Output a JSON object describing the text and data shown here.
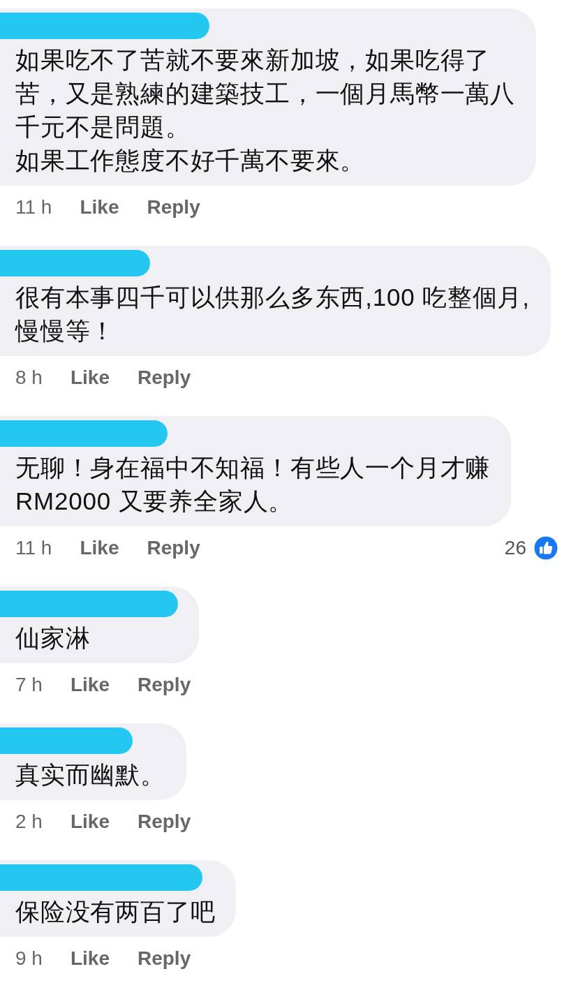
{
  "comments": [
    {
      "lines": [
        "如果吃不了苦就不要來新加坡，如果吃得了",
        "苦，又是熟練的建築技工，一個月馬幣一萬八",
        "千元不是問題。",
        "如果工作態度不好千萬不要來。"
      ],
      "time": "11 h",
      "actions": [
        "Like",
        "Reply"
      ]
    },
    {
      "lines": [
        "很有本事四千可以供那么多东西,100 吃整個月,",
        "慢慢等！"
      ],
      "time": "8 h",
      "actions": [
        "Like",
        "Reply"
      ]
    },
    {
      "lines": [
        "无聊！身在福中不知福！有些人一个月才赚",
        "RM2000 又要养全家人。"
      ],
      "time": "11 h",
      "actions": [
        "Like",
        "Reply"
      ],
      "reactions": "26"
    },
    {
      "lines": [
        "仙家淋"
      ],
      "time": "7 h",
      "actions": [
        "Like",
        "Reply"
      ]
    },
    {
      "lines": [
        "真实而幽默。"
      ],
      "time": "2 h",
      "actions": [
        "Like",
        "Reply"
      ]
    },
    {
      "lines": [
        "保险没有两百了吧"
      ],
      "time": "9 h",
      "actions": [
        "Like",
        "Reply"
      ]
    }
  ]
}
